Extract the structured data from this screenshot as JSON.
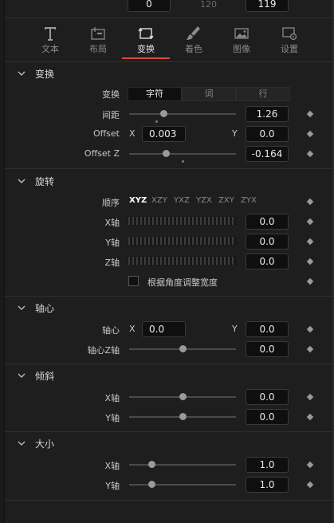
{
  "top_fields": {
    "left_value": "0",
    "mid_value": "120",
    "right_value": "119"
  },
  "tabs": [
    {
      "label": "文本",
      "icon": "text-icon"
    },
    {
      "label": "布局",
      "icon": "layout-icon"
    },
    {
      "label": "变换",
      "icon": "transform-icon",
      "active": true
    },
    {
      "label": "着色",
      "icon": "brush-icon"
    },
    {
      "label": "图像",
      "icon": "image-icon"
    },
    {
      "label": "设置",
      "icon": "settings-icon"
    }
  ],
  "transform": {
    "title": "变换",
    "mode_label": "变换",
    "modes": [
      "字符",
      "词",
      "行"
    ],
    "spacing_label": "间距",
    "spacing_value": "1.26",
    "offset_label": "Offset",
    "offset_x_label": "X",
    "offset_x_value": "0.003",
    "offset_y_label": "Y",
    "offset_y_value": "0.0",
    "offset_z_label": "Offset Z",
    "offset_z_value": "-0.164"
  },
  "rotation": {
    "title": "旋转",
    "order_label": "顺序",
    "orders": [
      "XYZ",
      "XZY",
      "YXZ",
      "YZX",
      "ZXY",
      "ZYX"
    ],
    "x_label": "X轴",
    "x_value": "0.0",
    "y_label": "Y轴",
    "y_value": "0.0",
    "z_label": "Z轴",
    "z_value": "0.0",
    "checkbox_label": "根据角度调整宽度"
  },
  "pivot": {
    "title": "轴心",
    "pivot_label": "轴心",
    "x_label": "X",
    "x_value": "0.0",
    "y_label": "Y",
    "y_value": "0.0",
    "z_label": "轴心Z轴",
    "z_value": "0.0"
  },
  "skew": {
    "title": "倾斜",
    "x_label": "X轴",
    "x_value": "0.0",
    "y_label": "Y轴",
    "y_value": "0.0"
  },
  "size": {
    "title": "大小",
    "x_label": "X轴",
    "x_value": "1.0",
    "y_label": "Y轴",
    "y_value": "1.0"
  }
}
